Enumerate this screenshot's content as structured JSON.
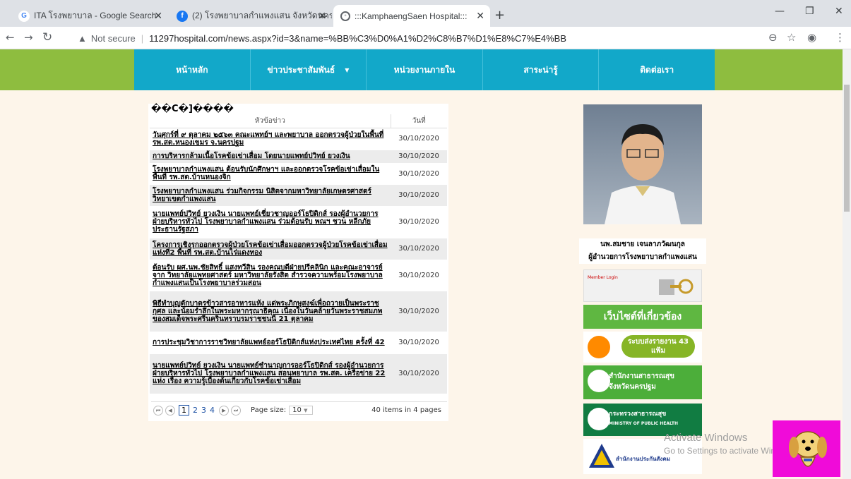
{
  "browser": {
    "tabs": [
      {
        "label": "ITA โรงพยาบาล - Google Search",
        "favicon": "G"
      },
      {
        "label": "(2) โรงพยาบาลกำแพงแสน จังหวัดนคร",
        "favicon": "f"
      },
      {
        "label": ":::KamphaengSaen Hospital:::",
        "favicon": "globe-icon"
      }
    ],
    "not_secure": "Not secure",
    "url": "11297hospital.com/news.aspx?id=3&name=%BB%C3%D0%A1%D2%C8%B7%D1%E8%C7%E4%BB"
  },
  "nav": {
    "items": [
      "หน้าหลัก",
      "ข่าวประชาสัมพันธ์",
      "หน่วยงานภายใน",
      "สาระน่ารู้",
      "ติดต่อเรา"
    ]
  },
  "news": {
    "title": "��C�]����",
    "col_title": "หัวข้อข่าว",
    "col_date": "วันที่",
    "rows": [
      {
        "title": "วันศุกร์ที่ ๙ ตุลาคม ๒๕๖๓ คณะแพทย์ฯ และพยาบาล ออกตรวจผู้ป่วยในพื้นที่ รพ.สต.หนองเขมร จ.นครปฐม",
        "date": "30/10/2020"
      },
      {
        "title": "การบริหารกล้ามเนื้อโรคข้อเข่าเสื่อม โดยนายแพทย์ปวิทย์ ยวงเงิน",
        "date": "30/10/2020"
      },
      {
        "title": "โรงพยาบาลกำแพงแสน ต้อนรับนักศึกษาฯ และออกตรวจโรคข้อเข่าเสื่อมในพื้นที่ รพ.สต.บ้านหนองจิก",
        "date": "30/10/2020"
      },
      {
        "title": "โรงพยาบาลกำแพงแสน ร่วมกิจกรรม นิสิตจากมหาวิทยาลัยเกษตรศาสตร์ วิทยาเขตกำแพงแสน",
        "date": "30/10/2020"
      },
      {
        "title": "นายแพทย์ปวิทย์ ยวงเงิน นายแพทย์เชี่ยวชาญออร์โธปิดิกส์ รองผู้อำนวยการฝ่ายบริหารทั่วไป โรงพยาบาลกำแพงแสน ร่วมต้อนรับ พณฯ ชวน หลีกภัย ประธานรัฐสภา",
        "date": "30/10/2020"
      },
      {
        "title": "โครงการเชิงรุกออกตรวจผู้ป่วยโรคข้อเข่าเสื่อมออกตรวจผู้ป่วยโรคข้อเข่าเสื่อม แห่งที่2 พื้นที่ รพ.สต.บ้านไร่แดงทอง",
        "date": "30/10/2020"
      },
      {
        "title": "ต้อนรับ ผศ.นพ.ชัยสิทธิ์ แสงทวีสิน รองคณบดีฝ่ายปรีคลินิก และคณะอาจารย์จาก วิทยาลัยแพทยศาสตร์ มหาวิทยาลัยรังสิต สำรวจความพร้อมโรงพยาบาลกำแพงแสนเป็นโรงพยาบาลร่วมสอน",
        "date": "30/10/2020"
      },
      {
        "title": "พิธีทำบุญตักบาตรข้าวสารอาหารแห้ง แด่พระภิกษุสงฆ์เพื่อถวายเป็นพระราชกุศล และน้อมรำลึกในพระมหากรุณาธิคุณ เนื่องในวันคล้ายวันพระราชสมภพของสมเด็จพระศรีนครินทราบรมราชชนนี 21 ตุลาคม",
        "date": "30/10/2020"
      },
      {
        "title": "การประชุมวิชาการราชวิทยาลัยแพทย์ออร์โธปิดิกส์แห่งประเทศไทย ครั้งที่ 42",
        "date": "30/10/2020"
      },
      {
        "title": "นายแพทย์ปวิทย์ ยวงเงิน นายแพทย์ชำนาญการออร์โธปิดิกส์ รองผู้อำนวยการฝ่ายบริหารทั่วไป โรงพยาบาลกำแพงแสน สอนพยาบาล รพ.สต. เครือข่าย 22 แห่ง เรื่อง ความรู้เบื้องต้นเกี่ยวกับโรคข้อเข่าเสื่อม",
        "date": "30/10/2020"
      }
    ],
    "pager": {
      "pages": [
        "1",
        "2",
        "3",
        "4"
      ],
      "current": "1",
      "size_label": "Page size:",
      "size": "10",
      "info": "40 items in 4 pages"
    }
  },
  "sidebar": {
    "director_name": "นพ.สมชาย เจนลาภวัฒนกุล",
    "director_title": "ผู้อำนวยการโรงพยาบาลกำแพงแสน",
    "login_label": "Member Login",
    "related_title": "เว็บไซต์ที่เกี่ยวข้อง",
    "link1": "ระบบส่งรายงาน 43 แฟ้ม",
    "link2_l1": "สำนักงานสาธารณสุข",
    "link2_l2": "จังหวัดนครปฐม",
    "link3_l1": "กระทรวงสาธารณสุข",
    "link3_l2": "MINISTRY OF PUBLIC HEALTH",
    "link4": "สำนักงานประกันสังคม"
  },
  "watermark": {
    "line1": "Activate Windows",
    "line2": "Go to Settings to activate Windows."
  },
  "colors": {
    "green_bar": "#8ebd3f",
    "nav_blue": "#12a8c9",
    "page_bg": "#fdf5ea"
  }
}
